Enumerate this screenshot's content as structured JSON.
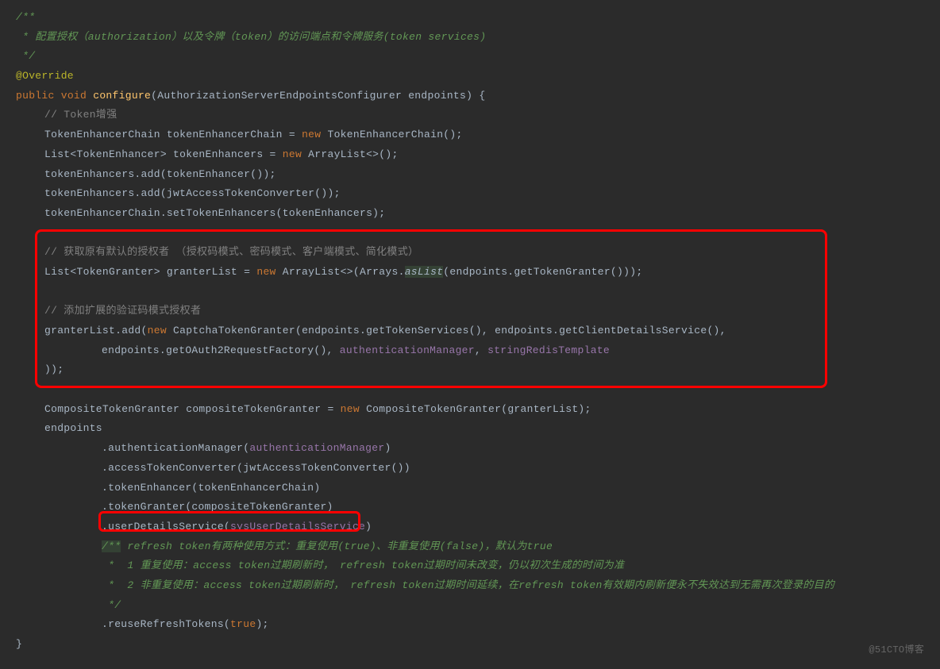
{
  "lines": {
    "c1": "/**",
    "c2": " * 配置授权（authorization）以及令牌（token）的访问端点和令牌服务(token services)",
    "c3": " */",
    "annotation": "@Override",
    "sig_public": "public",
    "sig_void": "void",
    "sig_method": "configure",
    "sig_params": "(AuthorizationServerEndpointsConfigurer endpoints) {",
    "cm_token": "// Token增强",
    "l1a": "TokenEnhancerChain tokenEnhancerChain = ",
    "l1_new": "new",
    "l1b": " TokenEnhancerChain();",
    "l2a": "List<TokenEnhancer> tokenEnhancers = ",
    "l2_new": "new",
    "l2b": " ArrayList<>();",
    "l3": "tokenEnhancers.add(tokenEnhancer",
    "l3b": "());",
    "l4": "tokenEnhancers.add(jwtAccessTokenConverter",
    "l4b": "());",
    "l5": "tokenEnhancerChain.setTokenEnhancers",
    "l5b": "(tokenEnhancers);",
    "cm_granter": "// 获取原有默认的授权者 （授权码模式、密码模式、客户端模式、简化模式）",
    "l6a": "List<TokenGranter> granterList = ",
    "l6_new": "new",
    "l6b": " ArrayList<>(Arrays.",
    "l6_asList": "asList",
    "l6c": "(endpoints.getTokenGranter()));",
    "cm_captcha": "// 添加扩展的验证码模式授权者",
    "l7a": "granterList.add(",
    "l7_new": "new",
    "l7b": " CaptchaTokenGranter(endpoints.getTokenServices(), endpoints.getClientDetailsService(),",
    "l8a": "endpoints.getOAuth2RequestFactory(), ",
    "l8_authMgr": "authenticationManager",
    "l8b": ", ",
    "l8_redis": "stringRedisTemplate",
    "l9": "));",
    "l10a": "CompositeTokenGranter compositeTokenGranter = ",
    "l10_new": "new",
    "l10b": " CompositeTokenGranter(granterList);",
    "l11": "endpoints",
    "l12a": ".authenticationManager(",
    "l12_field": "authenticationManager",
    "l12b": ")",
    "l13a": ".accessTokenConverter(jwtAccessTokenConverter",
    "l13b": "())",
    "l14": ".tokenEnhancer(tokenEnhancerChain)",
    "l15": ".tokenGranter(compositeTokenGranter)",
    "l16a": ".userDetailsService(",
    "l16_field": "sysUserDetailsService",
    "l16b": ")",
    "doc1_start": "/**",
    "doc1": " refresh token有两种使用方式：重复使用(true)、非重复使用(false)，默认为true",
    "doc2": " *  1 重复使用：access token过期刷新时， refresh token过期时间未改变，仍以初次生成的时间为准",
    "doc3": " *  2 非重复使用：access token过期刷新时， refresh token过期时间延续，在refresh token有效期内刷新便永不失效达到无需再次登录的目的",
    "doc4": " */",
    "l17a": ".reuseRefreshTokens(",
    "l17_true": "true",
    "l17b": ");",
    "close": "}"
  },
  "watermark": "@51CTO博客"
}
